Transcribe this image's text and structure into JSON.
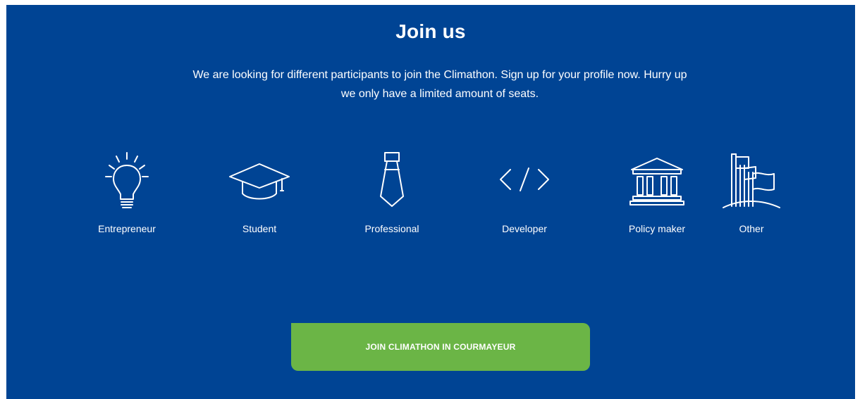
{
  "section": {
    "title": "Join us",
    "intro_line1": "We are looking for different participants to join the Climathon. Sign up for your profile now. Hurry up",
    "intro_line2": "we only have a limited amount of seats."
  },
  "roles": [
    {
      "label": "Entrepreneur",
      "icon": "lightbulb-icon"
    },
    {
      "label": "Student",
      "icon": "graduation-cap-icon"
    },
    {
      "label": "Professional",
      "icon": "tie-icon"
    },
    {
      "label": "Developer",
      "icon": "code-icon"
    },
    {
      "label": "Policy maker",
      "icon": "government-building-icon"
    },
    {
      "label": "Other",
      "icon": "flags-icon"
    }
  ],
  "cta": {
    "label": "JOIN CLIMATHON IN COURMAYEUR"
  },
  "colors": {
    "panel_background": "#004494",
    "cta_background": "#6bb546",
    "text": "#ffffff"
  }
}
